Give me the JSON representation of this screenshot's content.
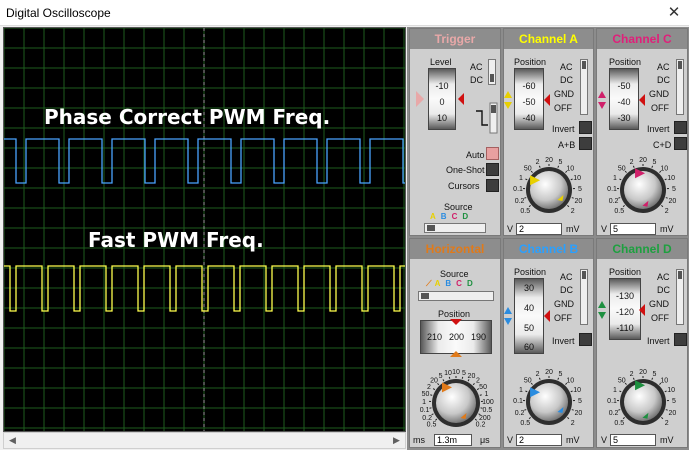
{
  "window": {
    "title": "Digital Oscilloscope",
    "close_glyph": "✕"
  },
  "screen": {
    "label_a": "Phase Correct PWM Freq.",
    "label_b": "Fast PWM Freq.",
    "trace_colors": {
      "blue": "#4aa3ff",
      "yellow": "#ffff4d"
    },
    "grid_color": "#1e5c1e"
  },
  "trigger": {
    "title": "Trigger",
    "level_label": "Level",
    "level_values": [
      "-10",
      "0",
      "10"
    ],
    "ac": "AC",
    "dc": "DC",
    "auto": "Auto",
    "oneshot": "One-Shot",
    "cursors": "Cursors",
    "source_label": "Source",
    "sources": [
      "A",
      "B",
      "C",
      "D"
    ]
  },
  "channel_a": {
    "title": "Channel A",
    "position_label": "Position",
    "position_values": [
      "-60",
      "-50",
      "-40"
    ],
    "ac": "AC",
    "dc": "DC",
    "gnd": "GND",
    "off": "OFF",
    "invert": "Invert",
    "extra": "A+B",
    "readout": "2",
    "unit_left": "V",
    "unit_right": "mV",
    "dial": [
      "0.5",
      "0.2",
      "0.1",
      "1",
      "50",
      "2",
      "20",
      "5",
      "10",
      "10",
      "5",
      "20",
      "2"
    ]
  },
  "channel_c": {
    "title": "Channel C",
    "position_label": "Position",
    "position_values": [
      "-50",
      "-40",
      "-30"
    ],
    "ac": "AC",
    "dc": "DC",
    "gnd": "GND",
    "off": "OFF",
    "invert": "Invert",
    "extra": "C+D",
    "readout": "5",
    "unit_left": "V",
    "unit_right": "mV",
    "dial": [
      "0.5",
      "0.2",
      "0.1",
      "1",
      "50",
      "2",
      "20",
      "5",
      "10",
      "10",
      "5",
      "20",
      "2"
    ]
  },
  "horizontal": {
    "title": "Horizontal",
    "source_label": "Source",
    "sources": [
      "A",
      "B",
      "C",
      "D"
    ],
    "position_label": "Position",
    "position_values": [
      "210",
      "200",
      "190"
    ],
    "readout": "1.3m",
    "unit_left": "ms",
    "unit_right": "μs",
    "dial": [
      "0.5",
      "0.2",
      "0.1",
      "1",
      "50",
      "2",
      "20",
      "5",
      "10",
      "10",
      "5",
      "20",
      "2",
      "50",
      "1",
      "100",
      "0.5",
      "200",
      "0.2"
    ]
  },
  "channel_b": {
    "title": "Channel B",
    "position_label": "Position",
    "position_values": [
      "30",
      "40",
      "50",
      "60"
    ],
    "ac": "AC",
    "dc": "DC",
    "gnd": "GND",
    "off": "OFF",
    "invert": "Invert",
    "readout": "2",
    "unit_left": "V",
    "unit_right": "mV",
    "dial": [
      "0.5",
      "0.2",
      "0.1",
      "1",
      "50",
      "2",
      "20",
      "5",
      "10",
      "10",
      "5",
      "20",
      "2"
    ]
  },
  "channel_d": {
    "title": "Channel D",
    "position_label": "Position",
    "position_values": [
      "-130",
      "-120",
      "-110"
    ],
    "ac": "AC",
    "dc": "DC",
    "gnd": "GND",
    "off": "OFF",
    "invert": "Invert",
    "readout": "5",
    "unit_left": "V",
    "unit_right": "mV",
    "dial": [
      "0.5",
      "0.2",
      "0.1",
      "1",
      "50",
      "2",
      "20",
      "5",
      "10",
      "10",
      "5",
      "20",
      "2"
    ]
  },
  "colors": {
    "trigger": "#e8a8a8",
    "channel_a": "#ffff00",
    "channel_b": "#2aa0ff",
    "channel_c": "#e0207a",
    "channel_d": "#1ea040",
    "horizontal": "#e07a1a"
  }
}
